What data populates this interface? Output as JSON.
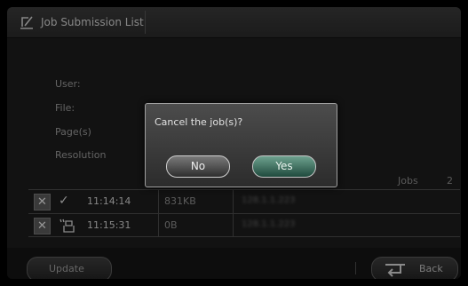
{
  "title": "Job Submission List",
  "info": {
    "user_label": "User:",
    "file_label": "File:",
    "pages_label": "Page(s)",
    "resolution_label": "Resolution"
  },
  "jobs": {
    "label": "Jobs",
    "count": "2"
  },
  "rows": [
    {
      "time": "11:14:14",
      "size": "831KB",
      "host": "128.1.1.223",
      "icon": "check-icon"
    },
    {
      "time": "11:15:31",
      "size": "0B",
      "host": "128.1.1.223",
      "icon": "printer-icon"
    }
  ],
  "bottom": {
    "update_label": "Update",
    "back_label": "Back"
  },
  "dialog": {
    "message": "Cancel the job(s)?",
    "no_label": "No",
    "yes_label": "Yes"
  },
  "colors": {
    "yes_button": "#3d7a64",
    "background": "#1d1d1d"
  }
}
